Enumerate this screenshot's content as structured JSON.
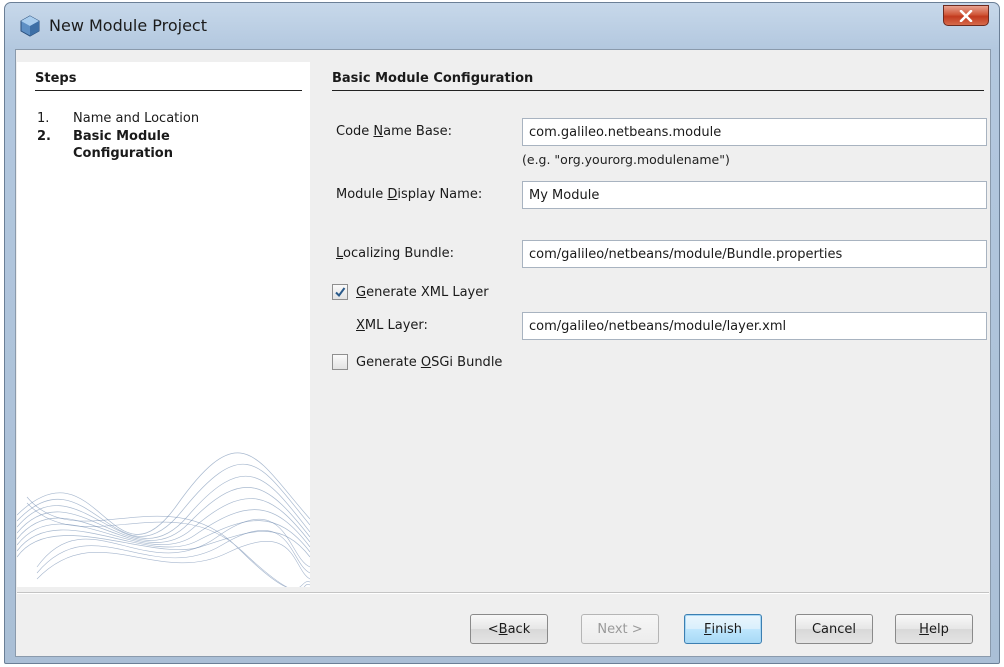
{
  "window": {
    "title": "New Module Project"
  },
  "steps": {
    "heading": "Steps",
    "items": [
      {
        "num": "1.",
        "label": "Name and Location",
        "current": false
      },
      {
        "num": "2.",
        "label": "Basic Module Configuration",
        "current": true
      }
    ]
  },
  "form": {
    "heading": "Basic Module Configuration",
    "code_name_base": {
      "label_pre": "Code ",
      "label_mnemonic": "N",
      "label_post": "ame Base:",
      "value": "com.galileo.netbeans.module",
      "hint": "(e.g. \"org.yourorg.modulename\")"
    },
    "display_name": {
      "label_pre": "Module ",
      "label_mnemonic": "D",
      "label_post": "isplay Name:",
      "value": "My Module"
    },
    "localizing_bundle": {
      "label_pre": "",
      "label_mnemonic": "L",
      "label_post": "ocalizing Bundle:",
      "value": "com/galileo/netbeans/module/Bundle.properties"
    },
    "generate_xml_layer": {
      "label_pre": "",
      "label_mnemonic": "G",
      "label_post": "enerate XML Layer",
      "checked": true
    },
    "xml_layer": {
      "label_pre": "",
      "label_mnemonic": "X",
      "label_post": "ML Layer:",
      "value": "com/galileo/netbeans/module/layer.xml"
    },
    "generate_osgi": {
      "label_pre": "Generate ",
      "label_mnemonic": "O",
      "label_post": "SGi Bundle",
      "checked": false
    }
  },
  "buttons": {
    "back": {
      "pre": "< ",
      "mnemonic": "B",
      "post": "ack"
    },
    "next": {
      "pre": "Next >",
      "mnemonic": "",
      "post": ""
    },
    "finish": {
      "pre": "",
      "mnemonic": "F",
      "post": "inish"
    },
    "cancel": {
      "pre": "Cancel",
      "mnemonic": "",
      "post": ""
    },
    "help": {
      "pre": "",
      "mnemonic": "H",
      "post": "elp"
    }
  },
  "icons": {
    "app": "netbeans-cube-icon",
    "close": "close-icon",
    "check": "checkmark-icon"
  },
  "colors": {
    "title_bar": "#b3c8df",
    "close_button": "#c9482b",
    "default_button": "#bee6fd"
  }
}
